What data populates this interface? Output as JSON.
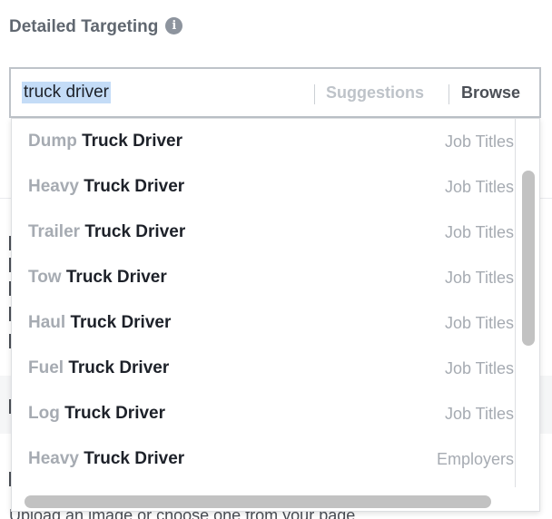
{
  "header": {
    "title": "Detailed Targeting",
    "info_icon": "info-icon"
  },
  "search": {
    "value": "truck driver",
    "tabs": {
      "suggestions": "Suggestions",
      "browse": "Browse"
    }
  },
  "results": [
    {
      "prefix": "Dump",
      "main": "Truck Driver",
      "category": "Job Titles"
    },
    {
      "prefix": "Heavy",
      "main": "Truck Driver",
      "category": "Job Titles"
    },
    {
      "prefix": "Trailer",
      "main": "Truck Driver",
      "category": "Job Titles"
    },
    {
      "prefix": "Tow",
      "main": "Truck Driver",
      "category": "Job Titles"
    },
    {
      "prefix": "Haul",
      "main": "Truck Driver",
      "category": "Job Titles"
    },
    {
      "prefix": "Fuel",
      "main": "Truck Driver",
      "category": "Job Titles"
    },
    {
      "prefix": "Log",
      "main": "Truck Driver",
      "category": "Job Titles"
    },
    {
      "prefix": "Heavy",
      "main": "Truck Driver",
      "category": "Employers"
    }
  ],
  "background": {
    "footer_text": "Upload an image or choose one from your page"
  },
  "colors": {
    "accent_selection": "#c4dcf7",
    "text_dark": "#1d2129",
    "text_muted": "#a6abb2"
  }
}
